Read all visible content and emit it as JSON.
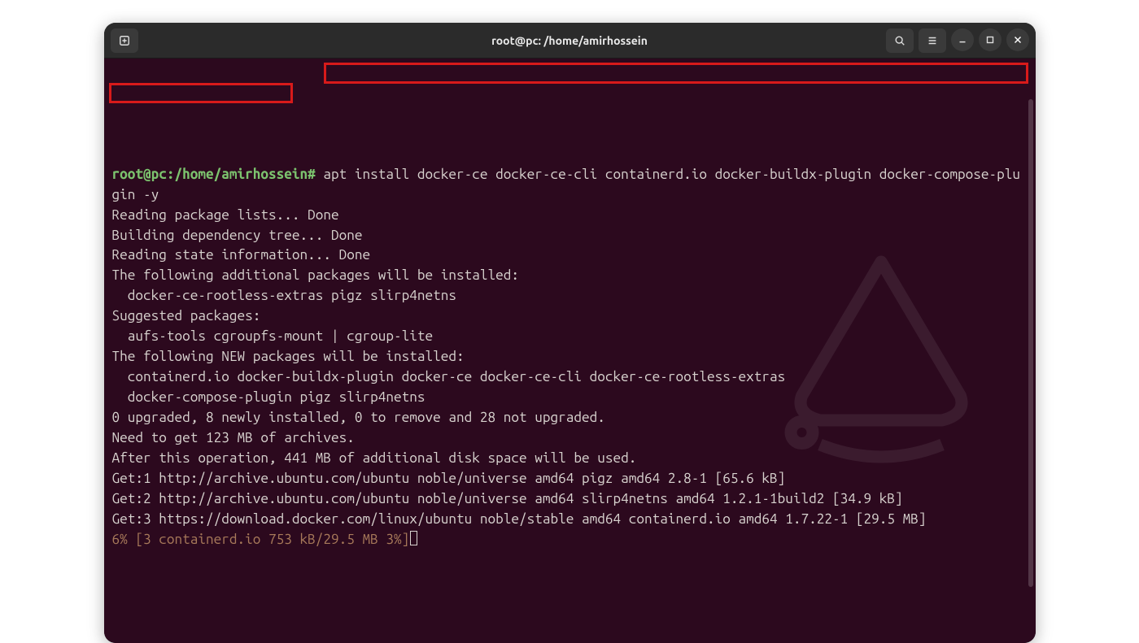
{
  "window": {
    "title": "root@pc: /home/amirhossein"
  },
  "titlebar": {
    "newtab_icon": "new-tab-icon",
    "search_icon": "search-icon",
    "menu_icon": "hamburger-menu-icon",
    "minimize_icon": "minimize-icon",
    "maximize_icon": "maximize-icon",
    "close_icon": "close-icon"
  },
  "terminal": {
    "prompt": "root@pc:/home/amirhossein#",
    "command": "apt install docker-ce docker-ce-cli containerd.io docker-buildx-plugin docker-compose-plugin -y",
    "output_lines": [
      "Reading package lists... Done",
      "Building dependency tree... Done",
      "Reading state information... Done",
      "The following additional packages will be installed:",
      "  docker-ce-rootless-extras pigz slirp4netns",
      "Suggested packages:",
      "  aufs-tools cgroupfs-mount | cgroup-lite",
      "The following NEW packages will be installed:",
      "  containerd.io docker-buildx-plugin docker-ce docker-ce-cli docker-ce-rootless-extras",
      "  docker-compose-plugin pigz slirp4netns",
      "0 upgraded, 8 newly installed, 0 to remove and 28 not upgraded.",
      "Need to get 123 MB of archives.",
      "After this operation, 441 MB of additional disk space will be used.",
      "Get:1 http://archive.ubuntu.com/ubuntu noble/universe amd64 pigz amd64 2.8-1 [65.6 kB]",
      "Get:2 http://archive.ubuntu.com/ubuntu noble/universe amd64 slirp4netns amd64 1.2.1-1build2 [34.9 kB]",
      "Get:3 https://download.docker.com/linux/ubuntu noble/stable amd64 containerd.io amd64 1.7.22-1 [29.5 MB]"
    ],
    "progress_line": "6% [3 containerd.io 753 kB/29.5 MB 3%]"
  }
}
